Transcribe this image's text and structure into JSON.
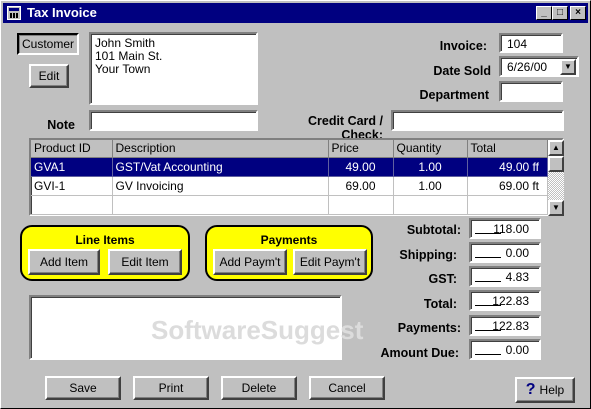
{
  "window": {
    "title": "Tax Invoice",
    "controls": {
      "minimize": "_",
      "maximize": "□",
      "close": "×"
    }
  },
  "customer": {
    "customer_button": "Customer",
    "edit_button": "Edit",
    "address_lines": [
      "John Smith",
      "101 Main St.",
      "Your Town"
    ]
  },
  "invoice": {
    "invoice_label": "Invoice:",
    "invoice_value": "104",
    "date_label": "Date Sold",
    "date_value": "6/26/00",
    "department_label": "Department",
    "department_value": ""
  },
  "note": {
    "label": "Note",
    "value": ""
  },
  "credit": {
    "label": "Credit Card / Check:",
    "value": ""
  },
  "grid": {
    "columns": [
      "Product ID",
      "Description",
      "Price",
      "Quantity",
      "Total"
    ],
    "rows": [
      {
        "product_id": "GVA1",
        "description": "GST/Vat Accounting",
        "price": "49.00",
        "quantity": "1.00",
        "total": "49.00 ff",
        "selected": true
      },
      {
        "product_id": "GVI-1",
        "description": "GV Invoicing",
        "price": "69.00",
        "quantity": "1.00",
        "total": "69.00 ft",
        "selected": false
      },
      {
        "product_id": "",
        "description": "",
        "price": "",
        "quantity": "",
        "total": "",
        "selected": false
      }
    ]
  },
  "line_items": {
    "title": "Line Items",
    "add": "Add Item",
    "edit": "Edit Item"
  },
  "payments": {
    "title": "Payments",
    "add": "Add Paym't",
    "edit": "Edit Paym't"
  },
  "totals": {
    "subtotal_label": "Subtotal:",
    "subtotal": "118.00",
    "shipping_label": "Shipping:",
    "shipping": "0.00",
    "gst_label": "GST:",
    "gst": "4.83",
    "total_label": "Total:",
    "total": "122.83",
    "payments_label": "Payments:",
    "payments": "122.83",
    "amount_due_label": "Amount Due:",
    "amount_due": "0.00"
  },
  "watermark": "SoftwareSuggest",
  "footer": {
    "save": "Save",
    "print": "Print",
    "delete": "Delete",
    "cancel": "Cancel",
    "help": "Help"
  },
  "colors": {
    "title_bar": "#000080",
    "panel_yellow": "#ffff00",
    "selection": "#000080",
    "face": "#c0c0c0"
  }
}
